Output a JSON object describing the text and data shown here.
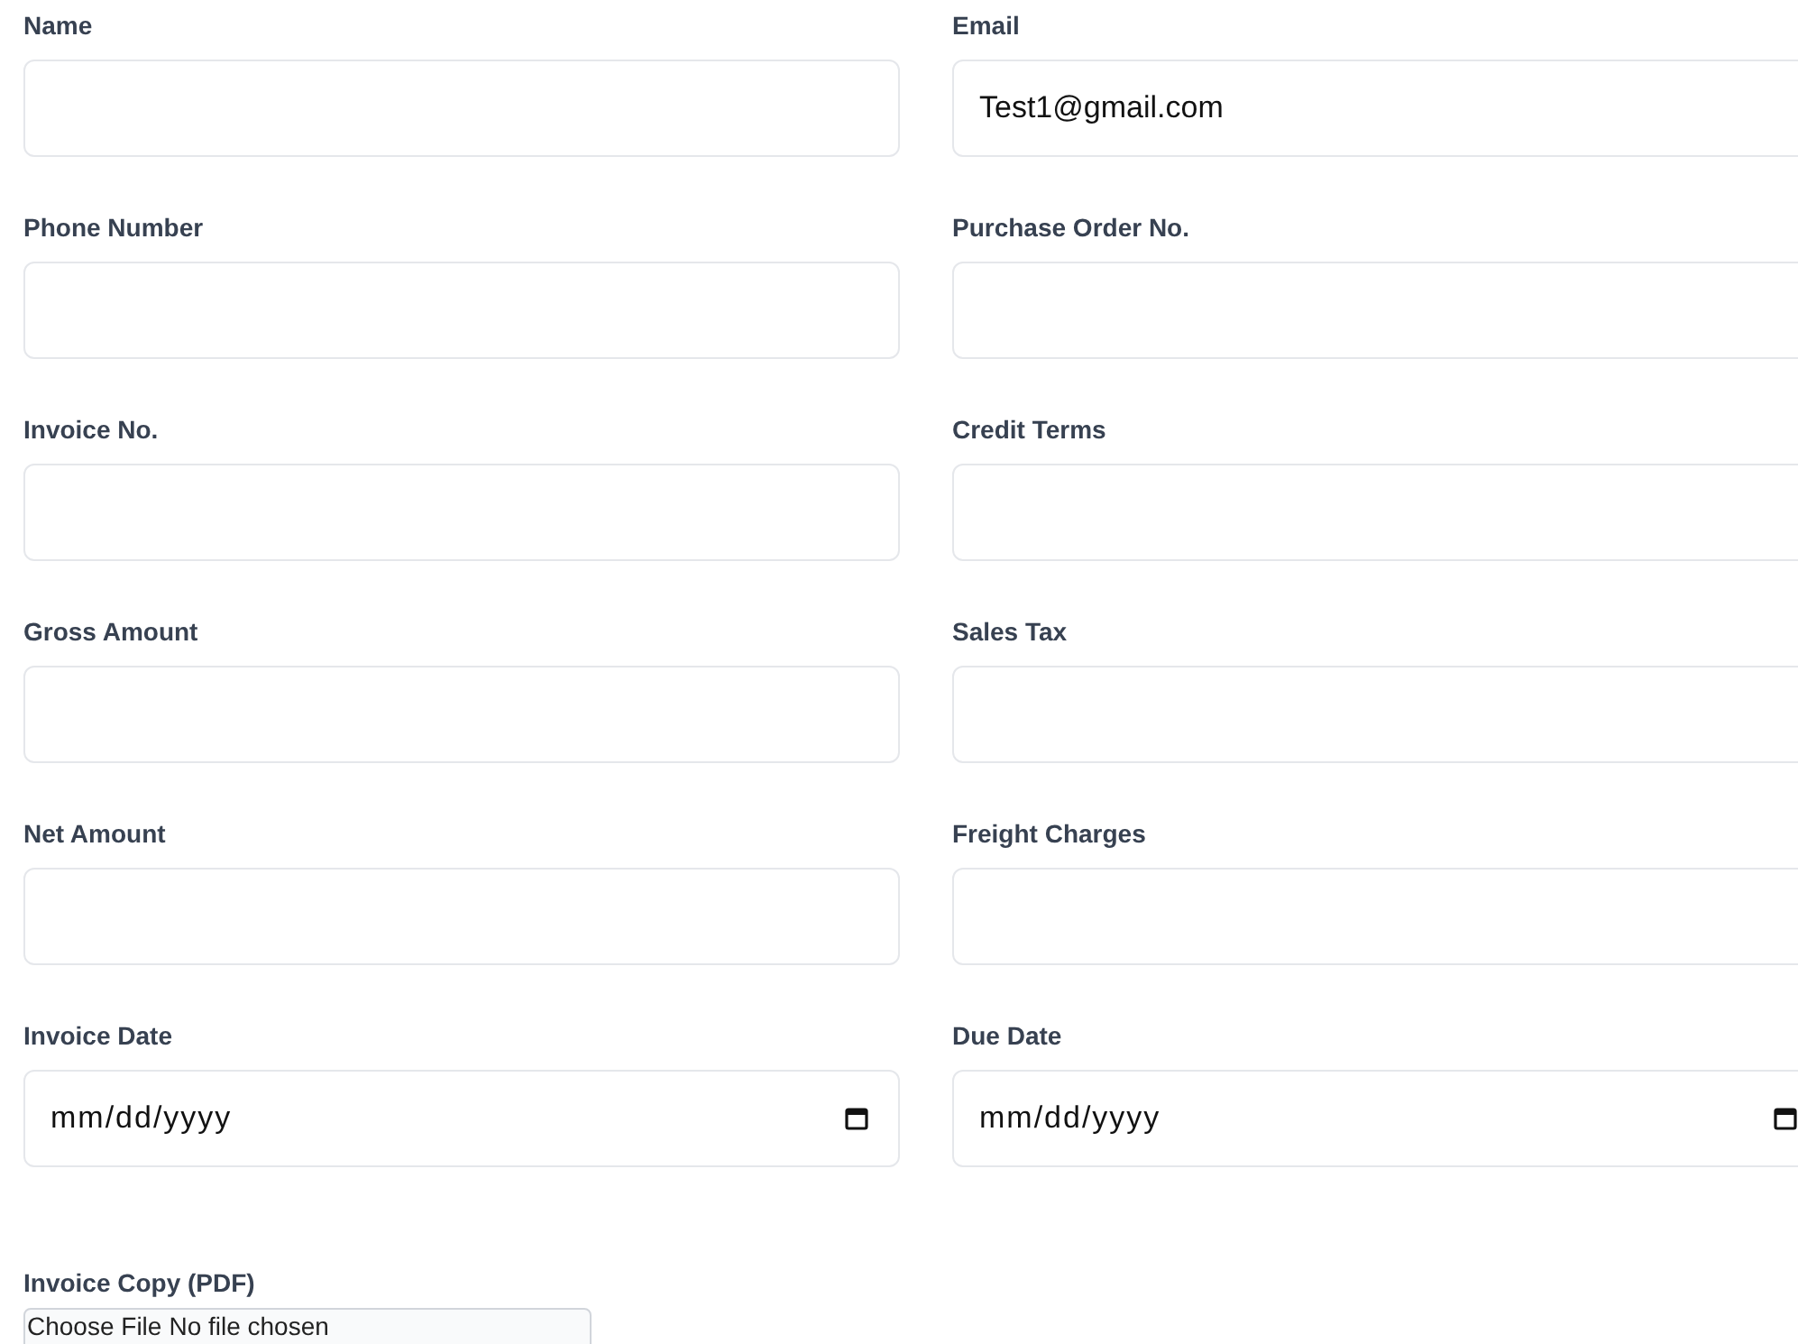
{
  "fields": [
    {
      "label": "Name",
      "kind": "text"
    },
    {
      "label": "Email",
      "kind": "text",
      "value": "Test1@gmail.com"
    },
    {
      "label": "Phone Number",
      "kind": "text"
    },
    {
      "label": "Purchase Order No.",
      "kind": "text"
    },
    {
      "label": "Invoice No.",
      "kind": "text"
    },
    {
      "label": "Credit Terms",
      "kind": "text"
    },
    {
      "label": "Gross Amount",
      "kind": "text"
    },
    {
      "label": "Sales Tax",
      "kind": "text"
    },
    {
      "label": "Net Amount",
      "kind": "text"
    },
    {
      "label": "Freight Charges",
      "kind": "text"
    },
    {
      "label": "Invoice Date",
      "kind": "date",
      "placeholder": "mm/dd/yyyy"
    },
    {
      "label": "Due Date",
      "kind": "date",
      "placeholder": "mm/dd/yyyy"
    }
  ],
  "file_upload": {
    "label": "Invoice Copy (PDF)",
    "button": "Choose File",
    "status": "No file chosen"
  }
}
